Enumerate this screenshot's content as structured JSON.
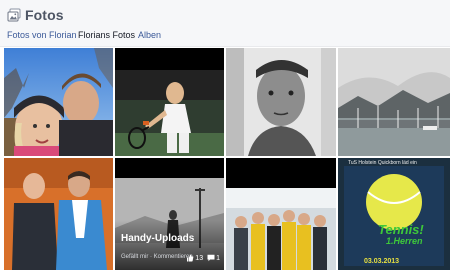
{
  "header": {
    "title": "Fotos",
    "icon": "photos-icon"
  },
  "tabs": [
    {
      "label": "Fotos von Florian",
      "active": false
    },
    {
      "label": "Florians Fotos",
      "active": true
    },
    {
      "label": "Alben",
      "active": false
    }
  ],
  "album": {
    "title": "Handy-Uploads",
    "actions": "Gefällt mir · Kommentieren",
    "like_count": "13",
    "comment_count": "1"
  },
  "poster": {
    "top_text": "TuS Holstein Quickborn läd ein",
    "headline": "Tennis!",
    "subline": "1.Herren",
    "date": "03.03.2013"
  },
  "colors": {
    "header_bg": "#f6f7f9",
    "title": "#4e5665",
    "link": "#3b5998",
    "active_tab": "#141823"
  }
}
